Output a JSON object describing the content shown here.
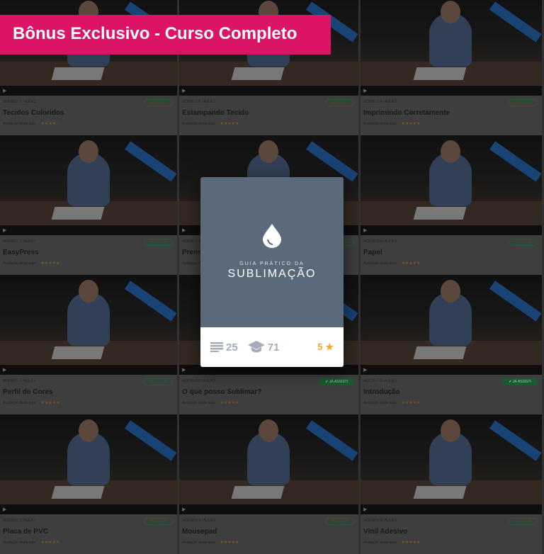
{
  "banner": "Bônus Exclusivo - Curso Completo",
  "rating_label": "Avaliação desta aula:",
  "lessons": [
    {
      "module": "MÓDULO 5 / AULA 2",
      "title": "Tecidos Coloridos",
      "badge": "ASSISTIR",
      "watched": false,
      "stars": "★★★★☆"
    },
    {
      "module": "MÓDULO 5 / AULA 1",
      "title": "Estampando Tecido",
      "badge": "ASSISTIR",
      "watched": false,
      "stars": "★★★★★"
    },
    {
      "module": "MÓDULO 4 / AULA 2",
      "title": "Imprimindo Corretamente",
      "badge": "ASSISTIR",
      "watched": false,
      "stars": "★★★★★"
    },
    {
      "module": "MÓDULO 3 / AULA 7",
      "title": "EasyPress",
      "badge": "ASSISTIR",
      "watched": false,
      "stars": "★★★★★"
    },
    {
      "module": "MÓDULO 3 / AULA 1",
      "title": "Prensa",
      "badge": "ASSISTIR",
      "watched": false,
      "stars": "★★★★★"
    },
    {
      "module": "MÓDULO 4 / AULA 3",
      "title": "Papel",
      "badge": "ASSISTIR",
      "watched": false,
      "stars": "★★★★★"
    },
    {
      "module": "MÓDULO 3 / AULA 4",
      "title": "Perfil de Cores",
      "badge": "ASSISTIR",
      "watched": false,
      "stars": "★★★★★"
    },
    {
      "module": "MÓDULO 2 / AULA 2",
      "title": "O que posso Sublimar?",
      "badge": "✔ JÁ ASSISTI",
      "watched": true,
      "stars": "★★★★★"
    },
    {
      "module": "MÓDULO 2 / AULA 1",
      "title": "Introdução",
      "badge": "✔ JÁ ASSISTI",
      "watched": true,
      "stars": "★★★★★"
    },
    {
      "module": "MÓDULO 3 / AULA 7",
      "title": "Placa de PVC",
      "badge": "ASSISTIR",
      "watched": false,
      "stars": "★★★★★"
    },
    {
      "module": "MÓDULO 4 / AULA 5",
      "title": "Mousepad",
      "badge": "ASSISTIR",
      "watched": false,
      "stars": "★★★★★"
    },
    {
      "module": "MÓDULO 3 / AULA 4",
      "title": "Vinil Adesivo",
      "badge": "ASSISTIR",
      "watched": false,
      "stars": "★★★★★"
    }
  ],
  "card": {
    "subtitle": "GUIA PRÁTICO DA",
    "title": "SUBLIMAÇÃO",
    "lessons_count": "25",
    "students_count": "71",
    "rating": "5"
  },
  "colors": {
    "banner": "#dc1466",
    "cover": "#5b6a7a",
    "star": "#f0a830"
  }
}
